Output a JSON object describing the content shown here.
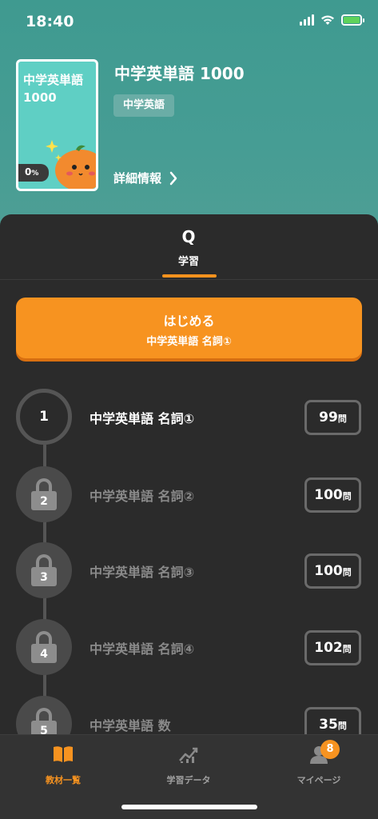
{
  "status_bar": {
    "time": "18:40"
  },
  "book": {
    "cover_title": "中学英単語",
    "cover_subtitle": "1000",
    "progress": "0",
    "progress_unit": "%",
    "title": "中学英単語 1000",
    "tag": "中学英語",
    "detail_link": "詳細情報"
  },
  "tabs": [
    {
      "label": "学習",
      "icon": "Q"
    }
  ],
  "start_button": {
    "label": "はじめる",
    "sublabel": "中学英単語 名詞①"
  },
  "lessons": [
    {
      "number": "1",
      "title": "中学英単語 名詞①",
      "count": "99",
      "unit": "問",
      "locked": false
    },
    {
      "number": "2",
      "title": "中学英単語 名詞②",
      "count": "100",
      "unit": "問",
      "locked": true
    },
    {
      "number": "3",
      "title": "中学英単語 名詞③",
      "count": "100",
      "unit": "問",
      "locked": true
    },
    {
      "number": "4",
      "title": "中学英単語 名詞④",
      "count": "102",
      "unit": "問",
      "locked": true
    },
    {
      "number": "5",
      "title": "中学英単語 数",
      "count": "35",
      "unit": "問",
      "locked": true
    }
  ],
  "bottom_nav": [
    {
      "label": "教材一覧",
      "icon": "book-icon",
      "active": true
    },
    {
      "label": "学習データ",
      "icon": "chart-icon",
      "active": false
    },
    {
      "label": "マイページ",
      "icon": "person-icon",
      "active": false,
      "badge": "8"
    }
  ],
  "colors": {
    "accent": "#f79320",
    "header": "#449c92",
    "background": "#2b2b2b"
  }
}
